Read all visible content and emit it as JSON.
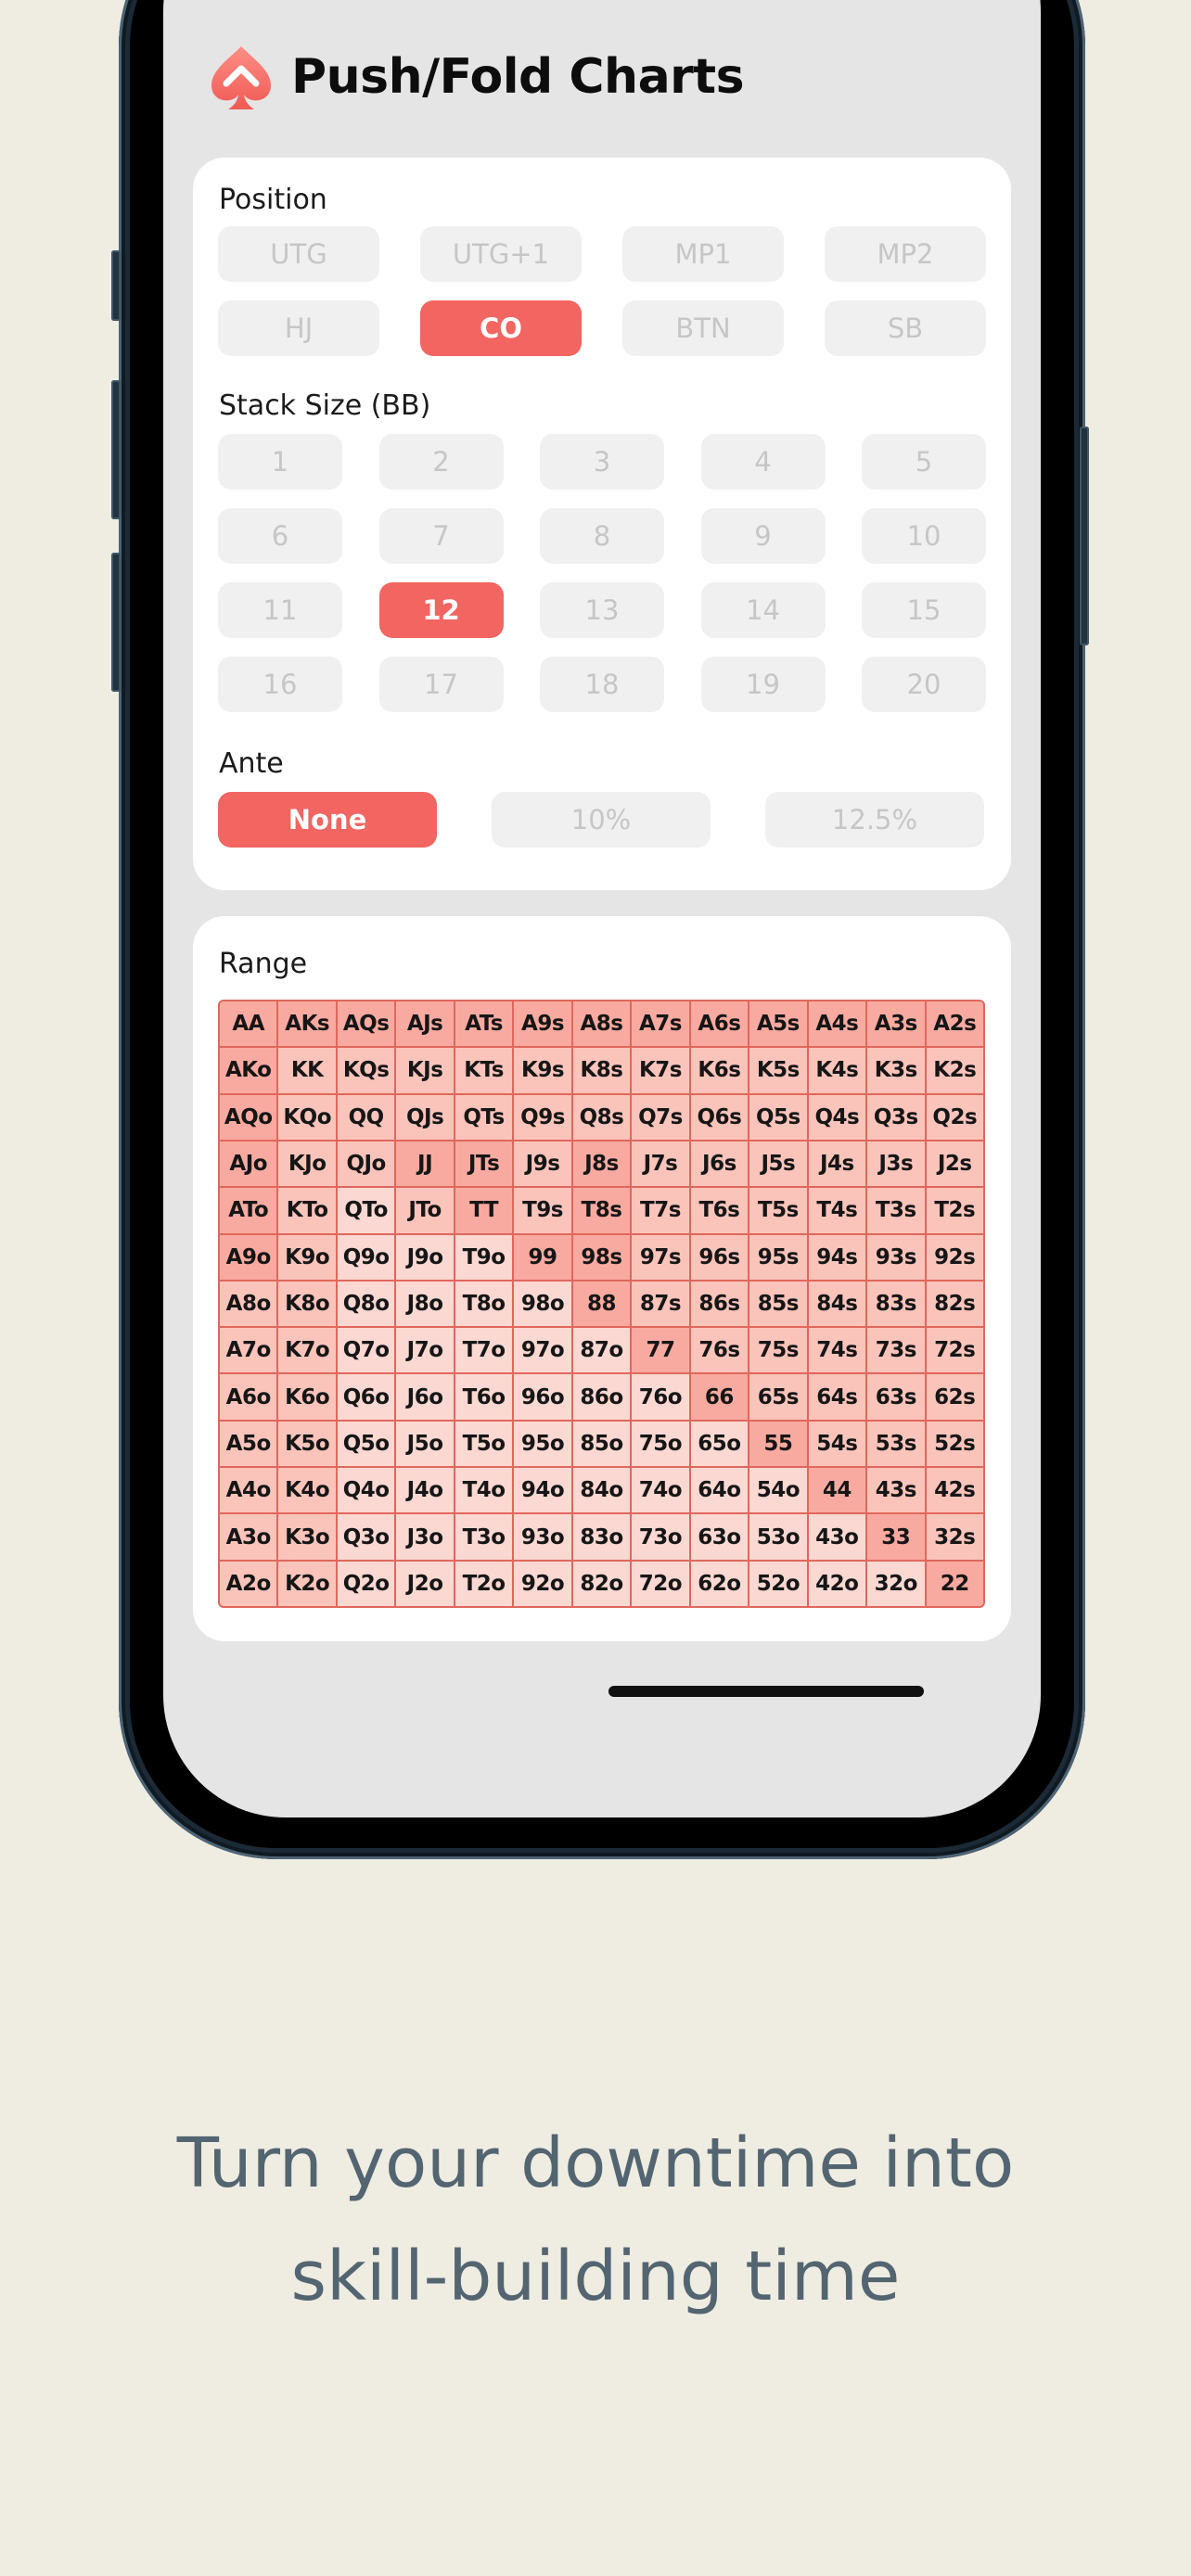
{
  "app": {
    "title": "Push/Fold Charts",
    "logo_icon": "spade-logo-icon",
    "accent_color": "#f26561"
  },
  "position": {
    "label": "Position",
    "options": [
      "UTG",
      "UTG+1",
      "MP1",
      "MP2",
      "HJ",
      "CO",
      "BTN",
      "SB"
    ],
    "selected": "CO"
  },
  "stack": {
    "label": "Stack Size (BB)",
    "options": [
      "1",
      "2",
      "3",
      "4",
      "5",
      "6",
      "7",
      "8",
      "9",
      "10",
      "11",
      "12",
      "13",
      "14",
      "15",
      "16",
      "17",
      "18",
      "19",
      "20"
    ],
    "selected": "12"
  },
  "ante": {
    "label": "Ante",
    "options": [
      "None",
      "10%",
      "12.5%"
    ],
    "selected": "None"
  },
  "range": {
    "label": "Range",
    "hands": [
      [
        "AA",
        "AKs",
        "AQs",
        "AJs",
        "ATs",
        "A9s",
        "A8s",
        "A7s",
        "A6s",
        "A5s",
        "A4s",
        "A3s",
        "A2s"
      ],
      [
        "AKo",
        "KK",
        "KQs",
        "KJs",
        "KTs",
        "K9s",
        "K8s",
        "K7s",
        "K6s",
        "K5s",
        "K4s",
        "K3s",
        "K2s"
      ],
      [
        "AQo",
        "KQo",
        "QQ",
        "QJs",
        "QTs",
        "Q9s",
        "Q8s",
        "Q7s",
        "Q6s",
        "Q5s",
        "Q4s",
        "Q3s",
        "Q2s"
      ],
      [
        "AJo",
        "KJo",
        "QJo",
        "JJ",
        "JTs",
        "J9s",
        "J8s",
        "J7s",
        "J6s",
        "J5s",
        "J4s",
        "J3s",
        "J2s"
      ],
      [
        "ATo",
        "KTo",
        "QTo",
        "JTo",
        "TT",
        "T9s",
        "T8s",
        "T7s",
        "T6s",
        "T5s",
        "T4s",
        "T3s",
        "T2s"
      ],
      [
        "A9o",
        "K9o",
        "Q9o",
        "J9o",
        "T9o",
        "99",
        "98s",
        "97s",
        "96s",
        "95s",
        "94s",
        "93s",
        "92s"
      ],
      [
        "A8o",
        "K8o",
        "Q8o",
        "J8o",
        "T8o",
        "98o",
        "88",
        "87s",
        "86s",
        "85s",
        "84s",
        "83s",
        "82s"
      ],
      [
        "A7o",
        "K7o",
        "Q7o",
        "J7o",
        "T7o",
        "97o",
        "87o",
        "77",
        "76s",
        "75s",
        "74s",
        "73s",
        "72s"
      ],
      [
        "A6o",
        "K6o",
        "Q6o",
        "J6o",
        "T6o",
        "96o",
        "86o",
        "76o",
        "66",
        "65s",
        "64s",
        "63s",
        "62s"
      ],
      [
        "A5o",
        "K5o",
        "Q5o",
        "J5o",
        "T5o",
        "95o",
        "85o",
        "75o",
        "65o",
        "55",
        "54s",
        "53s",
        "52s"
      ],
      [
        "A4o",
        "K4o",
        "Q4o",
        "J4o",
        "T4o",
        "94o",
        "84o",
        "74o",
        "64o",
        "54o",
        "44",
        "43s",
        "42s"
      ],
      [
        "A3o",
        "K3o",
        "Q3o",
        "J3o",
        "T3o",
        "93o",
        "83o",
        "73o",
        "63o",
        "53o",
        "43o",
        "33",
        "32s"
      ],
      [
        "A2o",
        "K2o",
        "Q2o",
        "J2o",
        "T2o",
        "92o",
        "82o",
        "72o",
        "62o",
        "52o",
        "42o",
        "32o",
        "22"
      ]
    ],
    "shading": [
      [
        2,
        2,
        2,
        2,
        2,
        2,
        2,
        2,
        2,
        2,
        2,
        2,
        2
      ],
      [
        2,
        1,
        1,
        1,
        1,
        1,
        1,
        1,
        1,
        1,
        1,
        1,
        1
      ],
      [
        2,
        1,
        1,
        1,
        1,
        1,
        1,
        1,
        1,
        1,
        1,
        1,
        1
      ],
      [
        2,
        1,
        1,
        2,
        2,
        1,
        2,
        1,
        1,
        1,
        1,
        1,
        1
      ],
      [
        2,
        1,
        0,
        1,
        2,
        1,
        2,
        1,
        1,
        1,
        1,
        1,
        1
      ],
      [
        2,
        1,
        0,
        0,
        0,
        2,
        2,
        1,
        1,
        1,
        1,
        1,
        1
      ],
      [
        1,
        1,
        0,
        0,
        0,
        0,
        2,
        1,
        1,
        1,
        1,
        1,
        1
      ],
      [
        1,
        1,
        0,
        0,
        0,
        0,
        0,
        2,
        1,
        1,
        1,
        1,
        1
      ],
      [
        1,
        1,
        0,
        0,
        0,
        0,
        0,
        0,
        2,
        1,
        1,
        1,
        1
      ],
      [
        1,
        1,
        0,
        0,
        0,
        0,
        0,
        0,
        0,
        2,
        1,
        1,
        1
      ],
      [
        1,
        1,
        0,
        0,
        0,
        0,
        0,
        0,
        0,
        0,
        2,
        1,
        1
      ],
      [
        1,
        1,
        0,
        0,
        0,
        0,
        0,
        0,
        0,
        0,
        0,
        2,
        1
      ],
      [
        1,
        1,
        0,
        0,
        0,
        0,
        0,
        0,
        0,
        0,
        0,
        0,
        2
      ]
    ],
    "shade_colors": [
      "#fcd8d2",
      "#fbc4bb",
      "#f9aaa0"
    ]
  },
  "tagline": {
    "line1": "Turn your downtime into",
    "line2": "skill-building time"
  }
}
